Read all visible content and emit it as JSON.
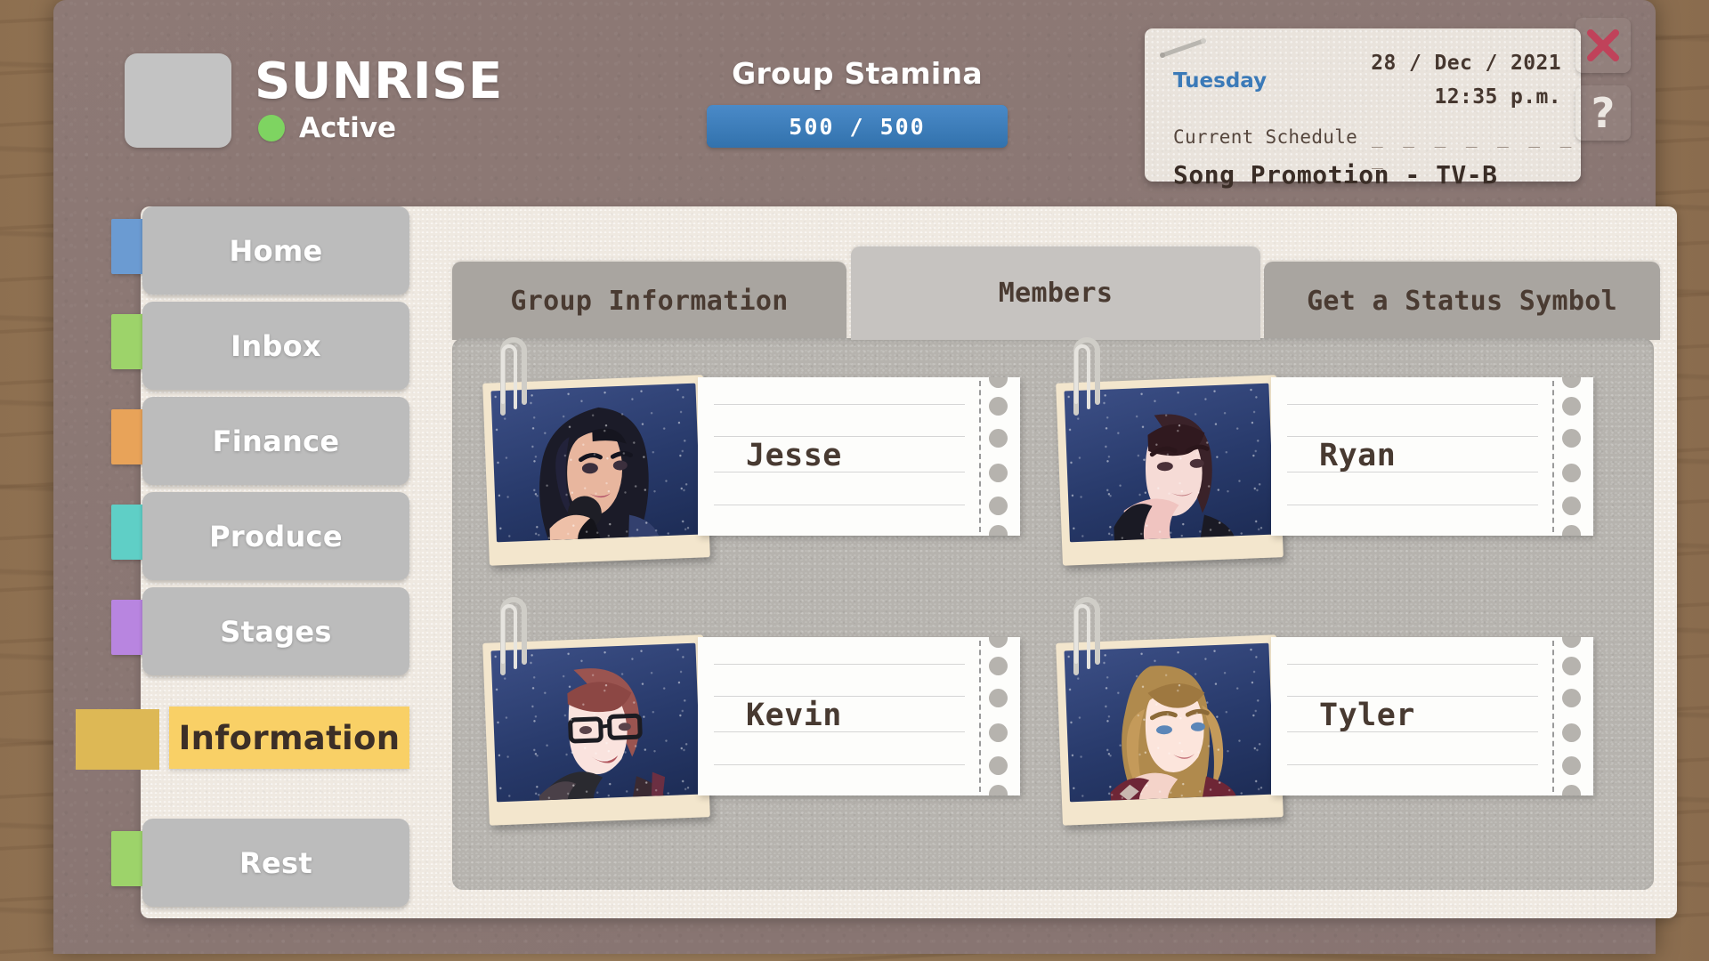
{
  "window": {
    "controls": [
      {
        "name": "close-button",
        "icon": "close-x-icon",
        "color": "#c0425a"
      },
      {
        "name": "help-button",
        "icon": "question-mark-icon",
        "label": "?",
        "color": "#ece7e2"
      }
    ]
  },
  "header": {
    "group_name": "SUNRISE",
    "status_label": "Active",
    "status_color": "#7ed461",
    "stamina": {
      "label": "Group Stamina",
      "current": 500,
      "max": 500,
      "value_text": "500 / 500",
      "bar_color": "#3272ad",
      "percent": 100
    }
  },
  "schedule": {
    "day": "Tuesday",
    "day_color": "#3b7ab8",
    "date": "28 / Dec / 2021",
    "time": "12:35 p.m.",
    "caption": "Current Schedule",
    "dashes": "_ _ _ _ _ _ _ _",
    "title": "Song Promotion - TV-B"
  },
  "sidebar": {
    "items": [
      {
        "label": "Home",
        "tab_color": "#6b9bd2",
        "active": false
      },
      {
        "label": "Inbox",
        "tab_color": "#9dd36a",
        "active": false
      },
      {
        "label": "Finance",
        "tab_color": "#e8a359",
        "active": false
      },
      {
        "label": "Produce",
        "tab_color": "#5fcfc6",
        "active": false
      },
      {
        "label": "Stages",
        "tab_color": "#b885e0",
        "active": false
      },
      {
        "label": "Information",
        "tab_color": "#f9d066",
        "active": true
      },
      {
        "label": "Rest",
        "tab_color": "#9dd36a",
        "active": false
      }
    ]
  },
  "tabs": [
    {
      "label": "Group Information",
      "active": false
    },
    {
      "label": "Members",
      "active": true
    },
    {
      "label": "Get a Status Symbol",
      "active": false
    }
  ],
  "members": [
    {
      "name": "Jesse",
      "portrait": "jesse"
    },
    {
      "name": "Ryan",
      "portrait": "ryan"
    },
    {
      "name": "Kevin",
      "portrait": "kevin"
    },
    {
      "name": "Tyler",
      "portrait": "tyler"
    }
  ]
}
